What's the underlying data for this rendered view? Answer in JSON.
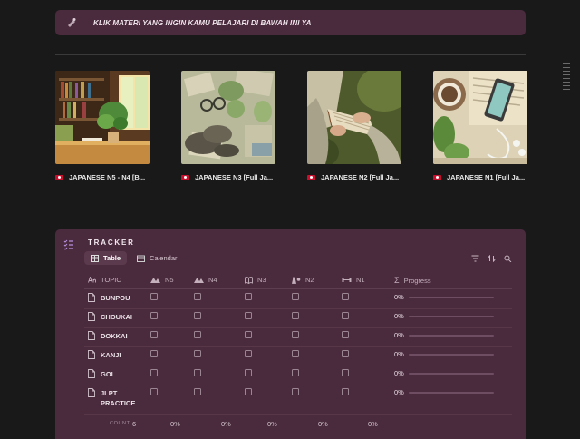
{
  "callout": {
    "text": "KLIK MATERI YANG INGIN KAMU PELAJARI DI BAWAH INI YA"
  },
  "cards": [
    {
      "title": "JAPANESE N5 - N4 [B..."
    },
    {
      "title": "JAPANESE N3 [Full Ja..."
    },
    {
      "title": "JAPANESE N2 [Full Ja..."
    },
    {
      "title": "JAPANESE N1 [Full Ja..."
    }
  ],
  "tracker": {
    "title": "TRACKER",
    "views": [
      "Table",
      "Calendar"
    ],
    "columns": {
      "topic": "TOPIC",
      "n5": "N5",
      "n4": "N4",
      "n3": "N3",
      "n2": "N2",
      "n1": "N1",
      "progress": "Progress"
    },
    "rows": [
      {
        "topic": "BUNPOU",
        "progress_text": "0%",
        "progress": 0
      },
      {
        "topic": "CHOUKAI",
        "progress_text": "0%",
        "progress": 0
      },
      {
        "topic": "DOKKAI",
        "progress_text": "0%",
        "progress": 0
      },
      {
        "topic": "KANJI",
        "progress_text": "0%",
        "progress": 0
      },
      {
        "topic": "GOI",
        "progress_text": "0%",
        "progress": 0
      },
      {
        "topic": "JLPT PRACTICE",
        "progress_text": "0%",
        "progress": 0
      }
    ],
    "footer": {
      "count_label": "COUNT",
      "count_value": "6",
      "n5": "0%",
      "n4": "0%",
      "n3": "0%",
      "n2": "0%",
      "n1": "0%"
    }
  },
  "colors": {
    "background": "#191919",
    "accent": "#4a2a3d",
    "flag": "#c8102e"
  }
}
